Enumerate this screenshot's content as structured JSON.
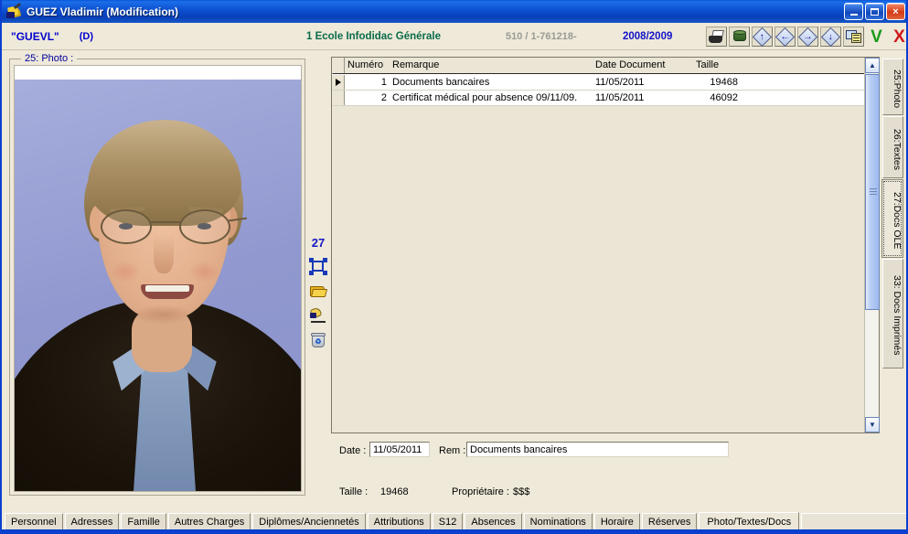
{
  "window": {
    "title": "GUEZ Vladimir (Modification)",
    "icon": "quill-pen-icon",
    "minimize_label": "Minimize",
    "maximize_label": "Maximize",
    "close_label": "×"
  },
  "header": {
    "code": "\"GUEVL\"",
    "flag": "(D)",
    "school": "1 Ecole Infodidac Générale",
    "record_number": "510  /  1-761218-",
    "school_year": "2008/2009",
    "toolbar": [
      {
        "name": "print-button",
        "icon": "printer-icon",
        "label": ""
      },
      {
        "name": "database-button",
        "icon": "database-drum-icon",
        "label": ""
      },
      {
        "name": "nav-first-button",
        "icon": "arrow-up-icon",
        "label": "↑"
      },
      {
        "name": "nav-prev-button",
        "icon": "arrow-left-icon",
        "label": "←"
      },
      {
        "name": "nav-next-button",
        "icon": "arrow-right-icon",
        "label": "→"
      },
      {
        "name": "nav-last-button",
        "icon": "arrow-down-icon",
        "label": "↓"
      },
      {
        "name": "notes-button",
        "icon": "notes-list-icon",
        "label": ""
      },
      {
        "name": "validate-button",
        "icon": "green-check-icon",
        "label": "V"
      },
      {
        "name": "cancel-button",
        "icon": "red-cross-icon",
        "label": "X"
      }
    ]
  },
  "photo_panel": {
    "group_label": "25: Photo :",
    "alt": "Portrait photograph of a smiling man with glasses wearing a dark sweater over a blue shirt"
  },
  "icon_column": {
    "number": "27",
    "icons": [
      {
        "name": "crop-frame-icon"
      },
      {
        "name": "open-folder-icon"
      },
      {
        "name": "edit-brush-icon"
      },
      {
        "name": "delete-trash-icon"
      }
    ]
  },
  "grid": {
    "columns": [
      "Numéro",
      "Remarque",
      "Date Document",
      "Taille"
    ],
    "rows": [
      {
        "selected": true,
        "numero": "1",
        "remarque": "Documents bancaires",
        "date": "11/05/2011",
        "taille": "19468"
      },
      {
        "selected": false,
        "numero": "2",
        "remarque": "Certificat médical pour absence 09/11/09.",
        "date": "11/05/2011",
        "taille": "46092"
      }
    ],
    "scrollbar": {
      "up_arrow": "▲",
      "down_arrow": "▼"
    }
  },
  "detail_form": {
    "date_label": "Date :",
    "date_value": "11/05/2011",
    "rem_label": "Rem :",
    "rem_value": "Documents bancaires",
    "taille_label": "Taille :",
    "taille_value": "19468",
    "proprietaire_label": "Propriétaire :",
    "proprietaire_value": "$$$"
  },
  "vertical_tabs": [
    {
      "label": "25:Photo",
      "active": false
    },
    {
      "label": "26:Textes",
      "active": false
    },
    {
      "label": "27:Docs OLE",
      "active": true
    },
    {
      "label": "33: Docs Imprimés",
      "active": false
    }
  ],
  "bottom_tabs": [
    {
      "label": "Personnel",
      "active": false
    },
    {
      "label": "Adresses",
      "active": false
    },
    {
      "label": "Famille",
      "active": false
    },
    {
      "label": "Autres Charges",
      "active": false
    },
    {
      "label": "Diplômes/Anciennetés",
      "active": false
    },
    {
      "label": "Attributions",
      "active": false
    },
    {
      "label": "S12",
      "active": false
    },
    {
      "label": "Absences",
      "active": false
    },
    {
      "label": "Nominations",
      "active": false
    },
    {
      "label": "Horaire",
      "active": false
    },
    {
      "label": "Réserves",
      "active": false
    },
    {
      "label": "Photo/Textes/Docs",
      "active": true
    }
  ],
  "colors": {
    "titlebar_blue": "#0c4fd0",
    "window_frame": "#0a3fd0",
    "panel_bg": "#eee9d9",
    "grid_bg": "#eae5d5",
    "link_blue": "#0000cc",
    "school_green": "#0a6b4a",
    "grey_number": "#9a9a94"
  }
}
